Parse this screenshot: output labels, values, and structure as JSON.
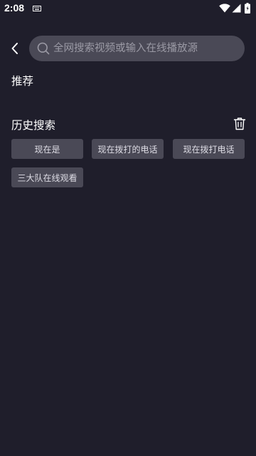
{
  "status_bar": {
    "time": "2:08"
  },
  "colors": {
    "background": "#1f1e2b",
    "chip": "#4a4956",
    "placeholder": "#9b9aa5",
    "text": "#ffffff"
  },
  "search": {
    "placeholder": "全网搜索视频或输入在线播放源"
  },
  "recommend": {
    "title": "推荐"
  },
  "history": {
    "title": "历史搜索",
    "items": [
      {
        "label": "现在是"
      },
      {
        "label": "现在拨打的电话"
      },
      {
        "label": "现在拨打电话"
      },
      {
        "label": "三大队在线观看"
      }
    ]
  },
  "icons": {
    "back": "chevron-left-icon",
    "search": "search-icon",
    "delete": "trash-icon"
  }
}
